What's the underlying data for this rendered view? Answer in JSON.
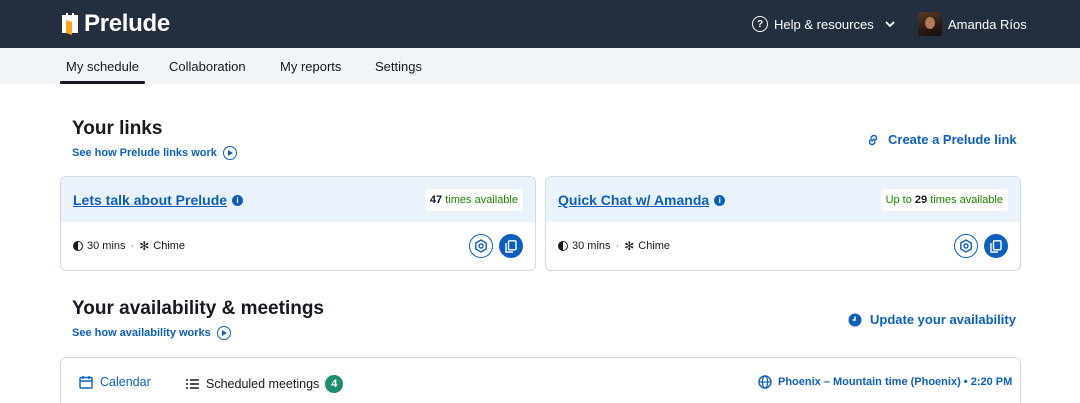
{
  "header": {
    "logo_text": "Prelude",
    "help_label": "Help & resources",
    "user_name": "Amanda Ríos"
  },
  "nav": {
    "tabs": [
      {
        "label": "My schedule",
        "active": true
      },
      {
        "label": "Collaboration",
        "active": false
      },
      {
        "label": "My reports",
        "active": false
      },
      {
        "label": "Settings",
        "active": false
      }
    ]
  },
  "links_section": {
    "title": "Your links",
    "learn_link": "See how Prelude links work",
    "create_label": "Create a Prelude link",
    "cards": [
      {
        "title": "Lets talk about Prelude",
        "avail_prefix": "",
        "avail_count": "47",
        "avail_suffix": "times available",
        "duration": "30 mins",
        "provider": "Chime"
      },
      {
        "title": "Quick Chat w/ Amanda",
        "avail_prefix": "Up to",
        "avail_count": "29",
        "avail_suffix": "times available",
        "duration": "30 mins",
        "provider": "Chime"
      }
    ]
  },
  "availability_section": {
    "title": "Your availability & meetings",
    "learn_link": "See how availability works",
    "update_label": "Update your availability",
    "tabs": {
      "calendar": "Calendar",
      "scheduled": "Scheduled meetings",
      "scheduled_count": "4"
    },
    "timezone": "Phoenix – Mountain time (Phoenix) • 2:20 PM"
  },
  "colors": {
    "header_bg": "#232f3e",
    "accent": "#0e5fbd",
    "available_green": "#1d8102",
    "badge_green": "#1d8c6f"
  }
}
